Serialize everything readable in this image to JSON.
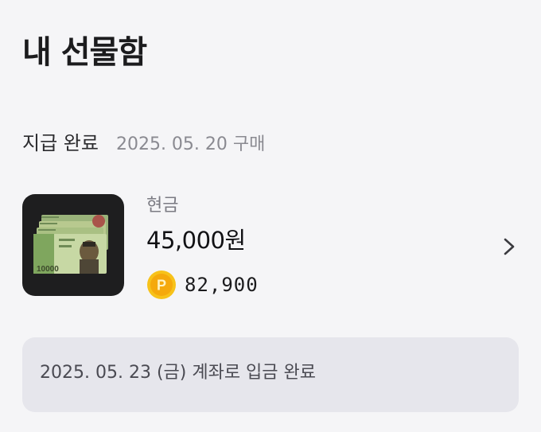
{
  "header": {
    "title": "내 선물함"
  },
  "order": {
    "status": "지급 완료",
    "purchase_date": "2025. 05. 20 구매"
  },
  "gift": {
    "name": "현금",
    "amount": "45,000원",
    "point_icon_letter": "P",
    "point_value": "82,900",
    "thumbnail_icon": "banknote-icon",
    "thumbnail_denomination": "10000"
  },
  "deposit": {
    "message": "2025. 05. 23 (금) 계좌로 입금 완료"
  },
  "colors": {
    "background": "#f5f5f7",
    "muted_text": "#8a8a91",
    "deposit_box": "#e6e6ec",
    "coin_gold": "#f7c21a"
  }
}
